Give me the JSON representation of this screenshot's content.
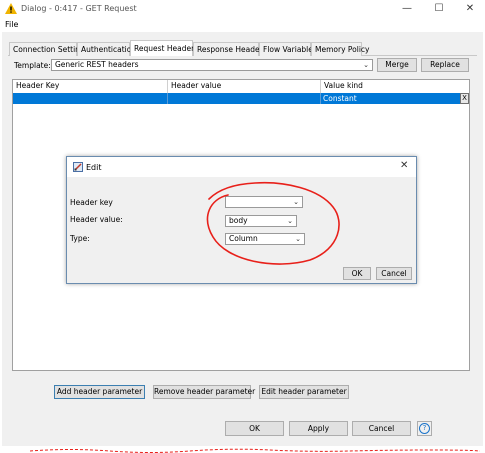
{
  "window": {
    "title": "Dialog - 0:417 - GET Request",
    "minimize": "—",
    "maximize": "☐",
    "close": "✕"
  },
  "menu": {
    "file": "File"
  },
  "tabs": [
    "Connection Settings",
    "Authentication",
    "Request Headers",
    "Response Headers",
    "Flow Variables",
    "Memory Policy"
  ],
  "active_tab": "Request Headers",
  "template": {
    "label": "Template:",
    "value": "Generic REST headers",
    "merge": "Merge",
    "replace": "Replace"
  },
  "table": {
    "columns": [
      "Header Key",
      "Header value",
      "Value kind"
    ],
    "rows": [
      {
        "key": "",
        "value": "",
        "kind": "Constant"
      }
    ],
    "remove_row": "X"
  },
  "edit_dialog": {
    "title": "Edit",
    "header_key_label": "Header key",
    "header_key_value": "",
    "header_value_label": "Header value:",
    "header_value_value": "body",
    "type_label": "Type:",
    "type_value": "Column",
    "ok": "OK",
    "cancel": "Cancel",
    "close": "✕",
    "annotation_color": "#e8201a"
  },
  "table_buttons": {
    "add": "Add header parameter",
    "remove": "Remove header parameter",
    "edit": "Edit header parameter"
  },
  "footer": {
    "ok": "OK",
    "apply": "Apply",
    "cancel": "Cancel",
    "help": "?"
  },
  "colors": {
    "selection": "#0078d7",
    "panel": "#f0f0f0",
    "warning": "#f0b400",
    "help": "#1a73c9"
  }
}
